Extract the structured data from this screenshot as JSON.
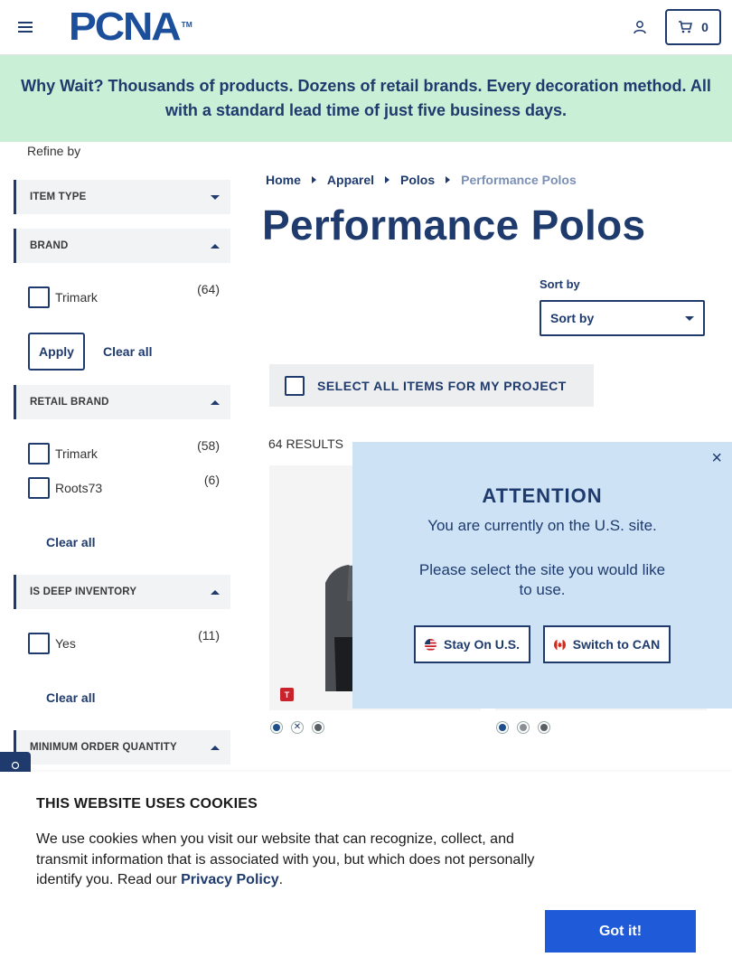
{
  "header": {
    "logo": "PCNA",
    "logo_tm": "TM",
    "cart_count": "0"
  },
  "promo": {
    "text": "Why Wait? Thousands of products. Dozens of retail brands. Every decoration method. All with a standard lead time of just five business days."
  },
  "sidebar": {
    "refine_label": "Refine by",
    "facets": {
      "item_type": {
        "title": "ITEM TYPE"
      },
      "brand": {
        "title": "BRAND",
        "options": [
          {
            "label": "Trimark",
            "count": "(64)"
          }
        ],
        "apply_label": "Apply",
        "clear_label": "Clear all"
      },
      "retail_brand": {
        "title": "RETAIL BRAND",
        "options": [
          {
            "label": "Trimark",
            "count": "(58)"
          },
          {
            "label": "Roots73",
            "count": "(6)"
          }
        ],
        "clear_label": "Clear all"
      },
      "deep_inventory": {
        "title": "IS DEEP INVENTORY",
        "options": [
          {
            "label": "Yes",
            "count": "(11)"
          }
        ],
        "clear_label": "Clear all"
      },
      "min_order": {
        "title": "MINIMUM ORDER QUANTITY"
      }
    }
  },
  "breadcrumb": [
    "Home",
    "Apparel",
    "Polos",
    "Performance Polos"
  ],
  "page_title": "Performance Polos",
  "sort": {
    "label": "Sort by",
    "selected": "Sort by"
  },
  "select_all": "SELECT ALL ITEMS FOR MY PROJECT",
  "results": "64 RESULTS",
  "products": [
    {
      "badge": "T",
      "swatches": [
        "#1d4f8c",
        "x",
        "#5a5f66"
      ]
    },
    {
      "swatches": [
        "#1d4f8c",
        "#8a8f96",
        "#5a5f66"
      ]
    }
  ],
  "modal": {
    "title": "ATTENTION",
    "line1": "You are currently on the U.S. site.",
    "line2": "Please select the site you would like to use.",
    "stay_label": "Stay On U.S.",
    "switch_label": "Switch to CAN",
    "close": "×"
  },
  "cookie": {
    "title": "THIS WEBSITE USES COOKIES",
    "text": "We use cookies when you visit our website that can recognize, collect, and transmit information that is associated with you, but which does not personally identify you. Read our",
    "link": "Privacy Policy",
    "period": ".",
    "button": "Got it!"
  },
  "colors": {
    "brand": "#1f3b6e",
    "promo_bg": "#c9efd7",
    "modal_bg": "#cde3f5",
    "cta": "#1f5bd8"
  }
}
